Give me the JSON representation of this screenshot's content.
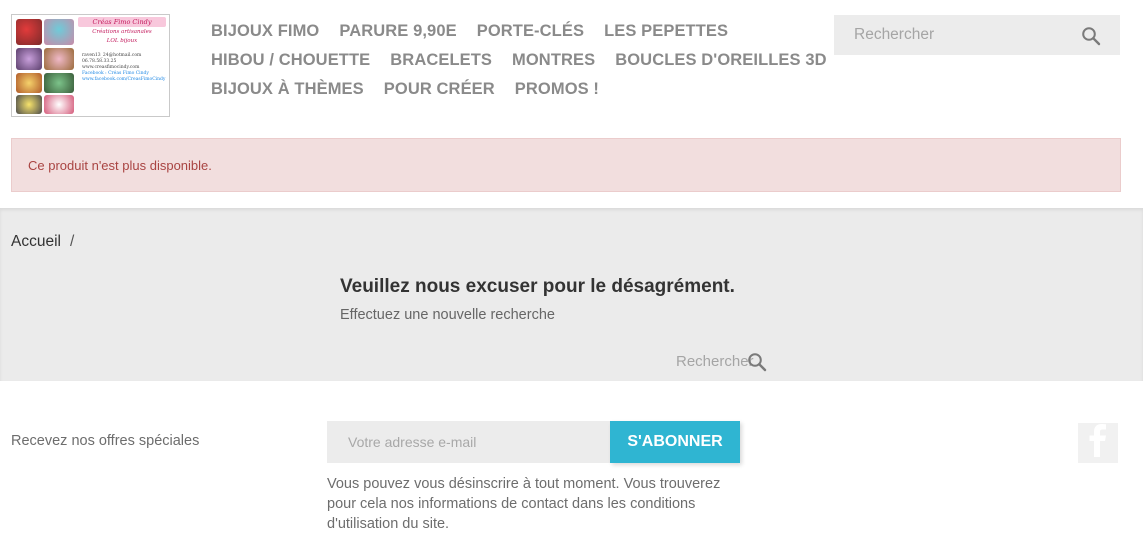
{
  "header": {
    "logo": {
      "brand": "Créas Fimo Cindy",
      "subtitle_1": "Créations artisanales",
      "subtitle_2": "LOL bijoux",
      "contact": [
        "raven13_24@hotmail.com",
        "06.78.58.33.25",
        "www.creasfimocindy.com",
        "Facebook : Créas Fimo Cindy",
        "www.facebook.com/CreasFimoCindy"
      ]
    },
    "nav": {
      "row1": [
        "BIJOUX FIMO",
        "PARURE 9,90E",
        "PORTE-CLÉS",
        "LES PEPETTES"
      ],
      "row2": [
        "HIBOU / CHOUETTE",
        "BRACELETS",
        "MONTRES",
        "BOUCLES D'OREILLES 3D"
      ],
      "row3": [
        "BIJOUX À THÈMES",
        "POUR CRÉER",
        "PROMOS !"
      ]
    },
    "search": {
      "placeholder": "Rechercher",
      "icon": "search-icon"
    }
  },
  "alert": {
    "message": "Ce produit n'est plus disponible.",
    "bg_color": "#f2dede",
    "text_color": "#a94442"
  },
  "main": {
    "breadcrumb": {
      "home": "Accueil",
      "separator": "/"
    },
    "title": "Veuillez nous excuser pour le désagrément.",
    "subtitle": "Effectuez une nouvelle recherche",
    "search": {
      "placeholder": "Rechercher",
      "icon": "search-icon"
    }
  },
  "footer": {
    "newsletter_label": "Recevez nos offres spéciales",
    "email_placeholder": "Votre adresse e-mail",
    "subscribe_label": "S'ABONNER",
    "accent_color": "#2fb5d2",
    "disclaimer": "Vous pouvez vous désinscrire à tout moment. Vous trouverez pour cela nos informations de contact dans les conditions d'utilisation du site.",
    "social_icon": "facebook-icon"
  }
}
